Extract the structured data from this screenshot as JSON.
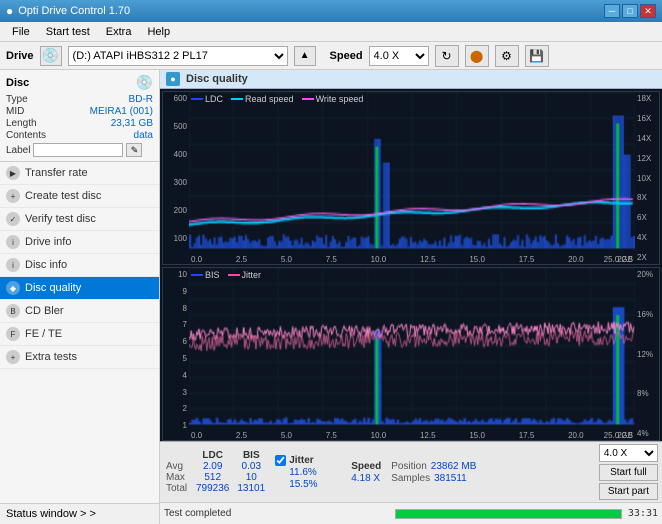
{
  "app": {
    "title": "Opti Drive Control 1.70",
    "title_icon": "●"
  },
  "title_controls": {
    "minimize": "─",
    "maximize": "□",
    "close": "✕"
  },
  "menu": {
    "items": [
      "File",
      "Start test",
      "Extra",
      "Help"
    ]
  },
  "drive_bar": {
    "label": "Drive",
    "drive_value": "(D:) ATAPI iHBS312 2 PL17",
    "speed_label": "Speed",
    "speed_value": "4.0 X"
  },
  "disc": {
    "title": "Disc",
    "type_label": "Type",
    "type_value": "BD-R",
    "mid_label": "MID",
    "mid_value": "MEIRA1 (001)",
    "length_label": "Length",
    "length_value": "23,31 GB",
    "contents_label": "Contents",
    "contents_value": "data",
    "label_label": "Label",
    "label_placeholder": ""
  },
  "nav": {
    "items": [
      {
        "id": "transfer-rate",
        "label": "Transfer rate"
      },
      {
        "id": "create-test-disc",
        "label": "Create test disc"
      },
      {
        "id": "verify-test-disc",
        "label": "Verify test disc"
      },
      {
        "id": "drive-info",
        "label": "Drive info"
      },
      {
        "id": "disc-info",
        "label": "Disc info"
      },
      {
        "id": "disc-quality",
        "label": "Disc quality",
        "active": true
      },
      {
        "id": "cd-bler",
        "label": "CD Bler"
      },
      {
        "id": "fe-te",
        "label": "FE / TE"
      },
      {
        "id": "extra-tests",
        "label": "Extra tests"
      }
    ],
    "status_window": "Status window > >"
  },
  "disc_quality": {
    "title": "Disc quality",
    "legend": {
      "ldc": "LDC",
      "read_speed": "Read speed",
      "write_speed": "Write speed",
      "bis": "BIS",
      "jitter": "Jitter"
    },
    "chart1": {
      "y_max": 600,
      "y_labels": [
        "600",
        "500",
        "400",
        "300",
        "200",
        "100"
      ],
      "y_right": [
        "18X",
        "16X",
        "14X",
        "12X",
        "10X",
        "8X",
        "6X",
        "4X",
        "2X"
      ],
      "x_labels": [
        "0.0",
        "2.5",
        "5.0",
        "7.5",
        "10.0",
        "12.5",
        "15.0",
        "17.5",
        "20.0",
        "22.5",
        "25.0"
      ]
    },
    "chart2": {
      "y_labels": [
        "10",
        "9",
        "8",
        "7",
        "6",
        "5",
        "4",
        "3",
        "2",
        "1"
      ],
      "y_right": [
        "20%",
        "16%",
        "12%",
        "8%",
        "4%"
      ],
      "x_labels": [
        "0.0",
        "2.5",
        "5.0",
        "7.5",
        "10.0",
        "12.5",
        "15.0",
        "17.5",
        "20.0",
        "22.5",
        "25.0"
      ]
    }
  },
  "stats": {
    "columns": [
      "LDC",
      "BIS",
      "",
      "Jitter",
      "Speed"
    ],
    "avg_label": "Avg",
    "avg_ldc": "2.09",
    "avg_bis": "0.03",
    "avg_jitter": "11.6%",
    "avg_speed": "4.18 X",
    "max_label": "Max",
    "max_ldc": "512",
    "max_bis": "10",
    "max_jitter": "15.5%",
    "position_label": "Position",
    "position_value": "23862 MB",
    "total_label": "Total",
    "total_ldc": "799236",
    "total_bis": "13101",
    "samples_label": "Samples",
    "samples_value": "381511",
    "speed_select": "4.0 X",
    "start_full": "Start full",
    "start_part": "Start part"
  },
  "bottom_bar": {
    "status": "Test completed",
    "progress": 100,
    "time": "33:31"
  }
}
